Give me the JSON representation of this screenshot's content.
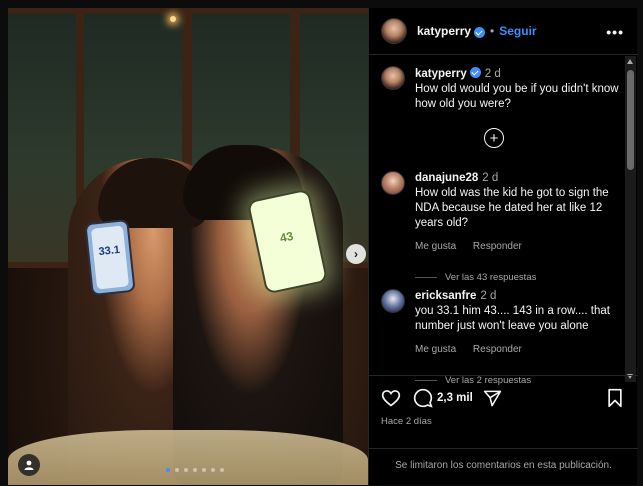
{
  "photo": {
    "left_phone_value": "33.1",
    "right_phone_value": "43",
    "carousel_dots": 7,
    "active_dot": 0
  },
  "header": {
    "username": "katyperry",
    "separator": "•",
    "follow_label": "Seguir",
    "more_label": "•••"
  },
  "caption": {
    "username": "katyperry",
    "time": "2 d",
    "text": "How old would you be if you didn't know how old you were?"
  },
  "comments": [
    {
      "username": "danajune28",
      "time": "2 d",
      "text": "How old was the kid he got to sign the NDA because he dated her at like 12 years old?",
      "like_label": "Me gusta",
      "reply_label": "Responder",
      "replies_label": "Ver las 43 respuestas"
    },
    {
      "username": "ericksanfre",
      "time": "2 d",
      "text": "you 33.1 him 43.... 143 in a row.... that number just won't leave you alone",
      "like_label": "Me gusta",
      "reply_label": "Responder",
      "replies_label": "Ver las 2 respuestas"
    }
  ],
  "actions": {
    "comment_count": "2,3 mil",
    "posted_ago": "Hace 2 días"
  },
  "footer": {
    "limited_text": "Se limitaron los comentarios en esta publicación."
  },
  "icons": [
    "heart-icon",
    "comment-icon",
    "share-icon",
    "bookmark-icon",
    "add-circle-icon",
    "chevron-right-icon",
    "user-tag-icon",
    "verified-icon",
    "more-icon"
  ],
  "colors": {
    "accent": "#3d8eff",
    "background": "#000000",
    "muted": "#a8a8a8"
  }
}
